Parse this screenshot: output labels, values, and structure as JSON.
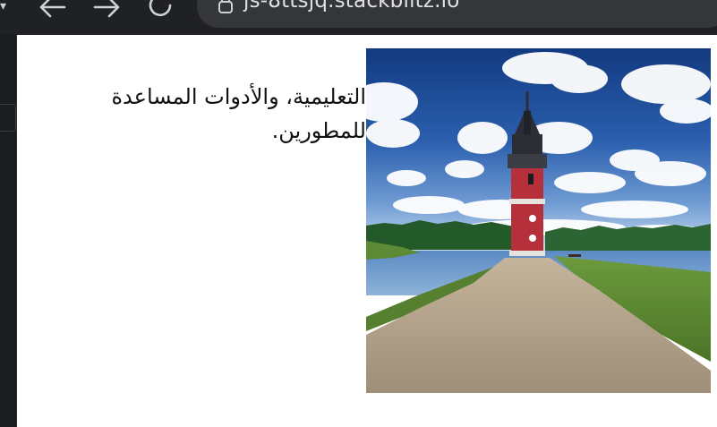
{
  "browser": {
    "url": "js-8ttsjq.stackblitz.io",
    "icons": {
      "back": "back-arrow-icon",
      "forward": "forward-arrow-icon",
      "reload": "reload-icon",
      "security": "lock-icon"
    },
    "colors": {
      "toolbar_bg": "#202124",
      "urlbar_bg": "#35363a",
      "url_text": "#dfe1e5"
    }
  },
  "content": {
    "paragraph": "التعليمية، والأدوات المساعدة للمطورين.",
    "image": {
      "subject": "lighthouse-photo",
      "colors": {
        "sky": "#1f4f9a",
        "tower": "#b5303a",
        "water": "#6f97c3",
        "path": "#b9a58d",
        "grass": "#5f8b33"
      }
    }
  }
}
